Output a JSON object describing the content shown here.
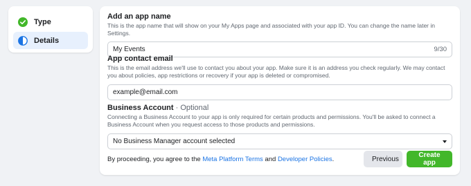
{
  "steps": [
    {
      "label": "Type",
      "status": "complete",
      "icon": "check-circle-icon"
    },
    {
      "label": "Details",
      "status": "active",
      "icon": "half-circle-icon"
    }
  ],
  "app_name": {
    "title": "Add an app name",
    "description": "This is the app name that will show on your My Apps page and associated with your app ID. You can change the name later in Settings.",
    "value": "My Events",
    "counter": "9/30"
  },
  "contact_email": {
    "title": "App contact email",
    "description": "This is the email address we'll use to contact you about your app. Make sure it is an address you check regularly. We may contact you about policies, app restrictions or recovery if your app is deleted or compromised.",
    "placeholder": "example@email.com"
  },
  "business_account": {
    "title": "Business Account",
    "optional": " · Optional",
    "description": "Connecting a Business Account to your app is only required for certain products and permissions. You'll be asked to connect a Business Account when you request access to those products and permissions.",
    "selected": "No Business Manager account selected"
  },
  "footer": {
    "terms_prefix": "By proceeding, you agree to the ",
    "terms_link": "Meta Platform Terms",
    "terms_and": " and ",
    "policies_link": "Developer Policies",
    "terms_suffix": ".",
    "previous_label": "Previous",
    "create_label": "Create app"
  },
  "colors": {
    "accent": "#1b74e4",
    "success": "#42b72a",
    "background": "#f0f2f5"
  }
}
